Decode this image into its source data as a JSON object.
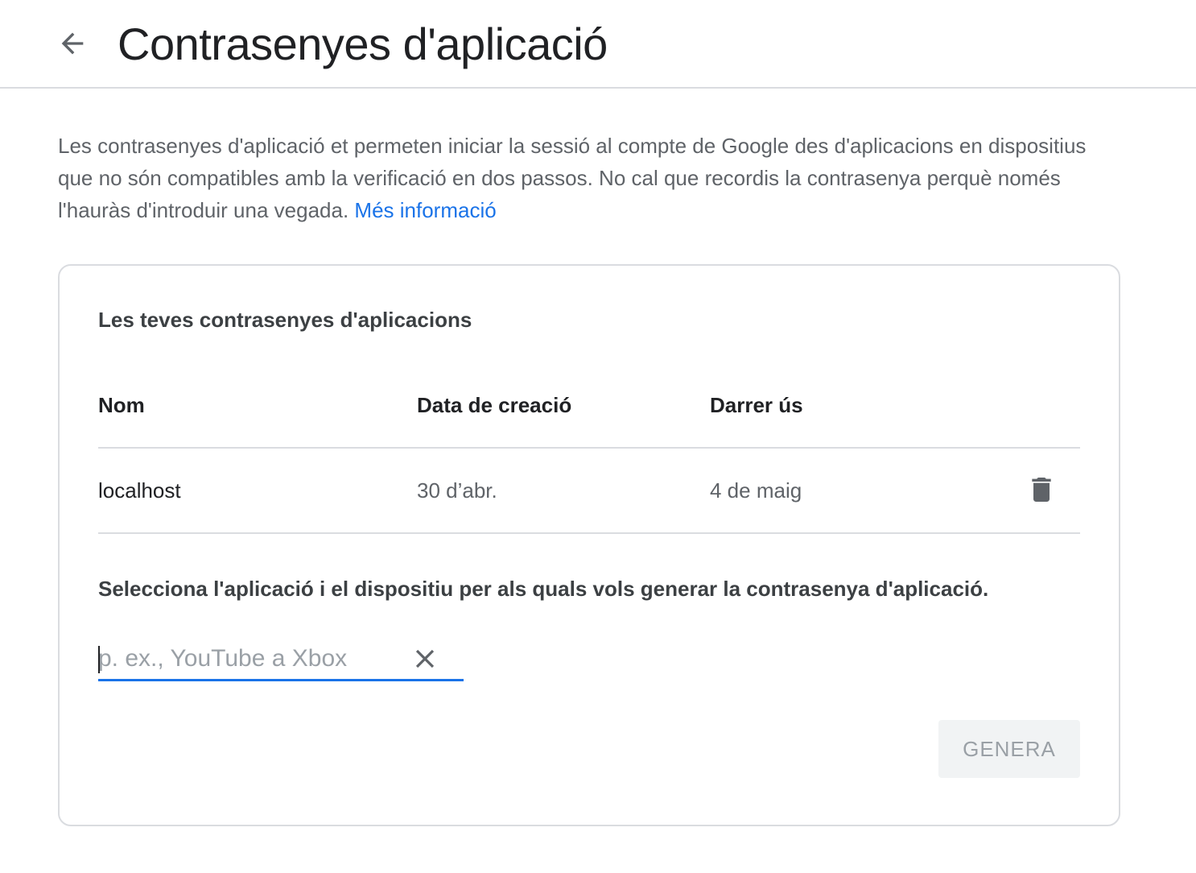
{
  "header": {
    "title": "Contrasenyes d'aplicació",
    "back_icon": "arrow-back-icon"
  },
  "intro": {
    "text": "Les contrasenyes d'aplicació et permeten iniciar la sessió al compte de Google des d'aplicacions en dispositius que no són compatibles amb la verificació en dos passos. No cal que recordis la contrasenya perquè només l'hauràs d'introduir una vegada. ",
    "link_label": "Més informació",
    "link_color": "#1a73e8"
  },
  "card": {
    "title": "Les teves contrasenyes d'aplicacions",
    "columns": [
      "Nom",
      "Data de creació",
      "Darrer ús"
    ],
    "rows": [
      {
        "name": "localhost",
        "created": "30 d’abr.",
        "last_used": "4 de maig",
        "delete_icon": "trash-icon"
      }
    ],
    "select_prompt": "Selecciona l'aplicació i el dispositiu per als quals vols generar la contrasenya d'aplicació.",
    "input": {
      "value": "",
      "placeholder": "p. ex., YouTube a Xbox",
      "clear_icon": "close-icon",
      "accent_color": "#1a73e8"
    },
    "generate_label": "GENERA"
  }
}
